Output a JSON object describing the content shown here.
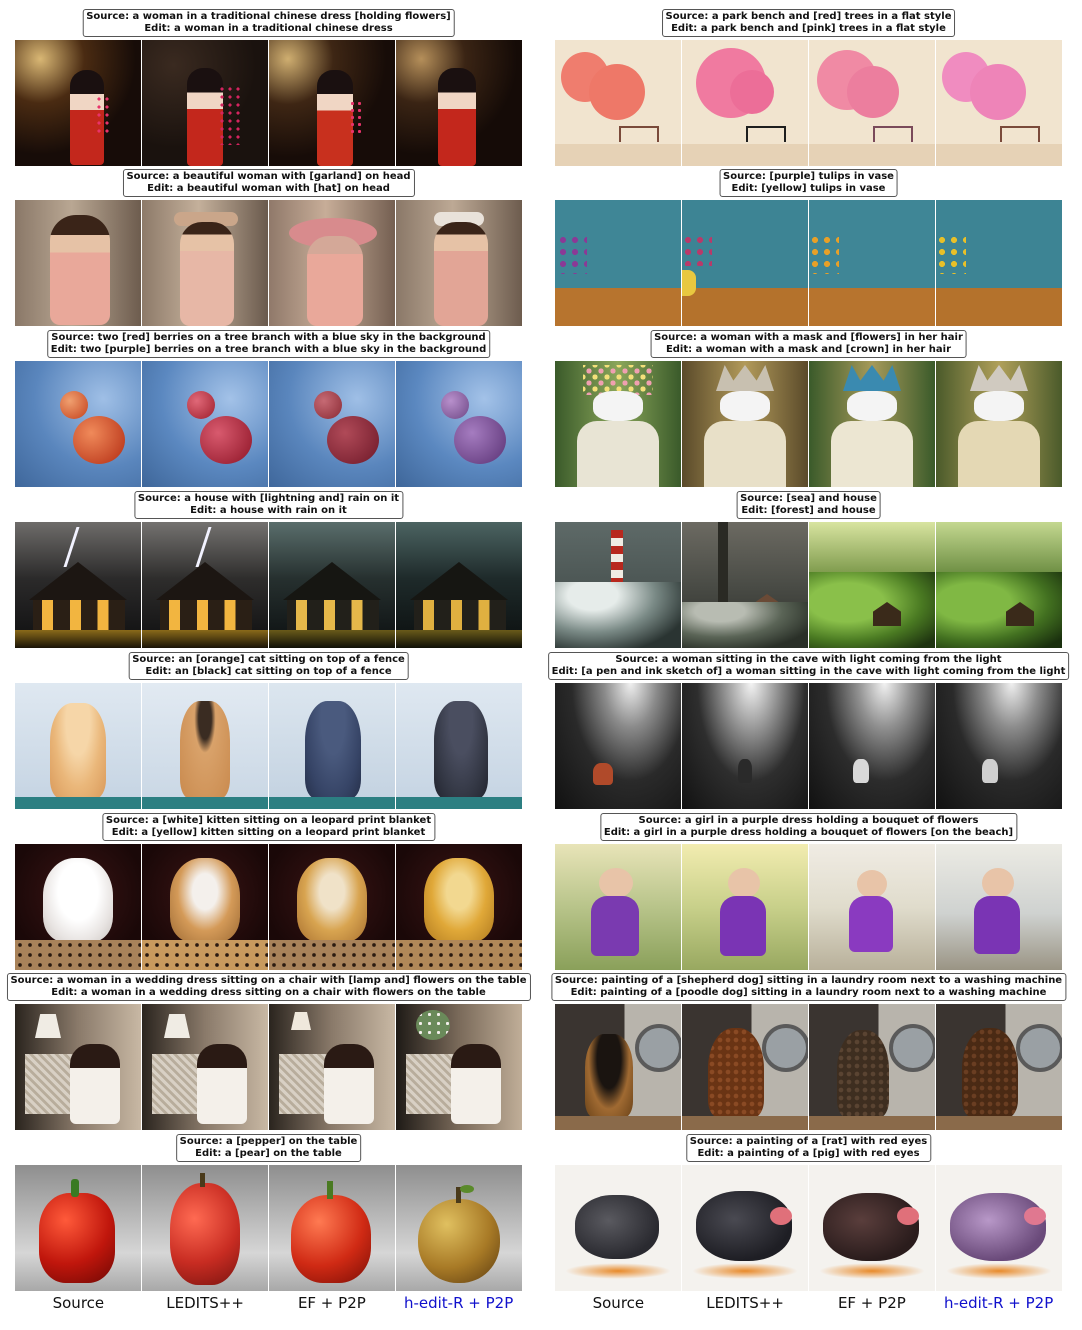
{
  "captions": {
    "l0": {
      "source": "Source: a woman in a traditional chinese dress [holding flowers]",
      "edit": "Edit: a woman in a traditional chinese dress"
    },
    "l1": {
      "source": "Source: a beautiful woman with [garland] on head",
      "edit": "Edit: a beautiful woman with [hat] on head"
    },
    "l2": {
      "source": "Source: two [red] berries on a tree branch with a blue sky in the background",
      "edit": "Edit: two [purple] berries on a tree branch with a blue sky in the background"
    },
    "l3": {
      "source": "Source: a house with [lightning and] rain on it",
      "edit": "Edit: a house with rain on it"
    },
    "l4": {
      "source": "Source: an [orange] cat sitting on top of a fence",
      "edit": "Edit: an [black] cat sitting on top of a fence"
    },
    "l5": {
      "source": "Source: a [white] kitten sitting on a leopard print blanket",
      "edit": "Edit: a [yellow] kitten sitting on a leopard print blanket"
    },
    "l6": {
      "source": "Source: a woman in a wedding dress sitting on a chair with [lamp and] flowers on the table",
      "edit": "Edit: a woman in a wedding dress sitting on a chair with flowers on the table"
    },
    "l7": {
      "source": "Source: a [pepper] on the table",
      "edit": "Edit: a [pear] on the table"
    },
    "r0": {
      "source": "Source: a park bench and [red] trees in a flat style",
      "edit": "Edit: a park bench and [pink] trees in a flat style"
    },
    "r1": {
      "source": "Source: [purple] tulips in vase",
      "edit": "Edit: [yellow] tulips in vase"
    },
    "r2": {
      "source": "Source: a woman with a mask and [flowers] in her hair",
      "edit": "Edit: a woman with a mask and [crown] in her hair"
    },
    "r3": {
      "source": "Source: [sea] and house",
      "edit": "Edit: [forest] and house"
    },
    "r4": {
      "source": "Source: a woman sitting in the cave with light coming from the light",
      "edit": "Edit: [a pen and ink sketch of] a woman sitting in the cave with light coming from the light"
    },
    "r5": {
      "source": "Source: a girl in a purple dress holding a bouquet of flowers",
      "edit": "Edit: a girl in a purple dress holding a bouquet of flowers [on the beach]"
    },
    "r6": {
      "source": "Source: painting of a [shepherd dog] sitting in a laundry room next to a washing machine",
      "edit": "Edit: painting of a [poodle dog] sitting in a laundry room next to a washing machine"
    },
    "r7": {
      "source": "Source: a painting of a [rat] with red eyes",
      "edit": "Edit: a painting of a [pig] with red eyes"
    }
  },
  "column_labels": {
    "source": "Source",
    "ledits": "LEDITS++",
    "ef": "EF + P2P",
    "hedit": "h-edit-R + P2P"
  },
  "colors": {
    "highlight_label": "#1010cc",
    "caption_border": "#555555"
  }
}
